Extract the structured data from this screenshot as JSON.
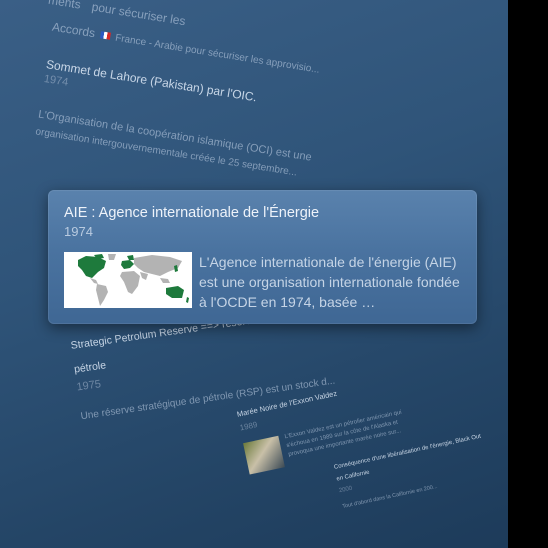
{
  "background_entries": {
    "top_line": "ments",
    "top_line_tail": "pour sécuriser les",
    "accords_label": "Accords",
    "accords_text": "France - Arabie pour sécuriser les approvisio...",
    "sommet_title": "Sommet de Lahore (Pakistan) par l'OIC.",
    "sommet_year": "1974",
    "oic_line1": "L'Organisation de la coopération islamique (OCI) est une",
    "oic_line2": "organisation intergouvernementale créée le 25 septembre...",
    "strategic_title_1": "Strategic Petrolum Reserve ==> réserve stratégique de",
    "strategic_title_2": "pétrole",
    "strategic_year": "1975",
    "strategic_desc": "Une réserve stratégique de pétrole (RSP) est un stock d...",
    "exxon_title": "Marée Noire de l'Exxon Valdez",
    "exxon_year": "1989",
    "exxon_desc_1": "L'Exxon Valdez est un pétrolier américain qui",
    "exxon_desc_2": "s'échoua en 1989 sur la côte de l'Alaska et",
    "exxon_desc_3": "provoqua une importante marée noire sur...",
    "crisis_title_1": "Conséquence d'une libéralisation de l'énergie, Black Out",
    "crisis_title_2": "en Californie",
    "crisis_year": "2000",
    "crisis_desc": "Tout d'abord dans la Californie en 200..."
  },
  "card": {
    "title": "AIE : Agence internationale de l'Énergie",
    "year": "1974",
    "description": "L'Agence internationale de l'énergie (AIE) est une organisation internationale fondée à l'OCDE en 1974, basée …"
  },
  "colors": {
    "background": "#2f5479",
    "card": "#4a73a0",
    "member_green": "#1e7a3c",
    "map_land": "#b3b3b3"
  }
}
